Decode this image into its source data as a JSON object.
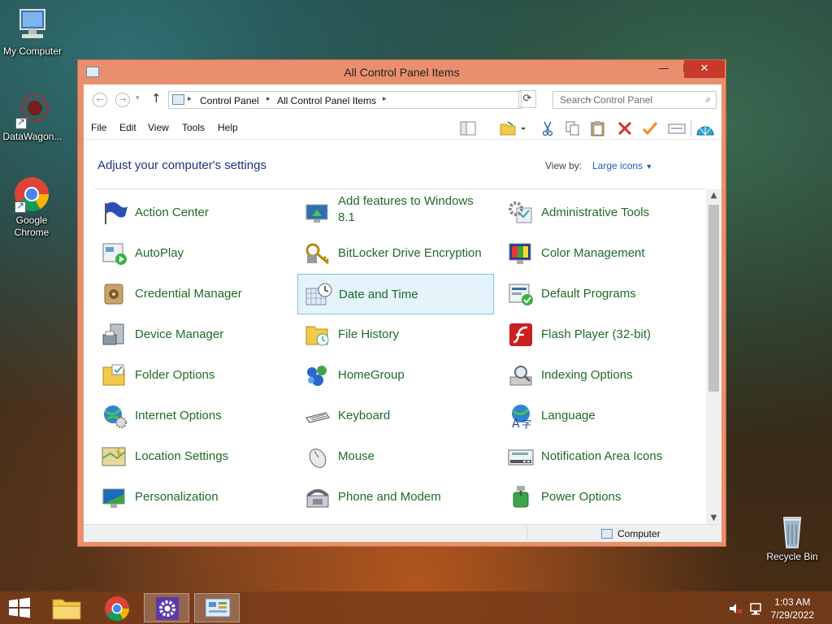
{
  "desktop": {
    "icons": [
      {
        "label": "My Computer"
      },
      {
        "label": "DataWagon..."
      },
      {
        "label": "Google Chrome"
      },
      {
        "label": "Recycle Bin"
      }
    ]
  },
  "window": {
    "title": "All Control Panel Items",
    "buttons": {
      "minimize": "—",
      "maximize": "☐",
      "close": "✕"
    },
    "breadcrumb": [
      "Control Panel",
      "All Control Panel Items"
    ],
    "search_placeholder": "Search Control Panel",
    "menu": [
      "File",
      "Edit",
      "View",
      "Tools",
      "Help"
    ],
    "heading": "Adjust your computer's settings",
    "view_by_label": "View by:",
    "view_by_value": "Large icons",
    "status": "Computer",
    "items": [
      {
        "label": "Action Center",
        "icon": "flag-icon"
      },
      {
        "label": "Add features to Windows 8.1",
        "icon": "monitor-upgrade-icon"
      },
      {
        "label": "Administrative Tools",
        "icon": "gear-tools-icon"
      },
      {
        "label": "AutoPlay",
        "icon": "autoplay-icon"
      },
      {
        "label": "BitLocker Drive Encryption",
        "icon": "key-lock-icon"
      },
      {
        "label": "Color Management",
        "icon": "color-monitor-icon"
      },
      {
        "label": "Credential Manager",
        "icon": "vault-icon"
      },
      {
        "label": "Date and Time",
        "icon": "calendar-clock-icon"
      },
      {
        "label": "Default Programs",
        "icon": "default-check-icon"
      },
      {
        "label": "Device Manager",
        "icon": "printer-device-icon"
      },
      {
        "label": "File History",
        "icon": "file-history-icon"
      },
      {
        "label": "Flash Player (32-bit)",
        "icon": "flash-icon"
      },
      {
        "label": "Folder Options",
        "icon": "folder-options-icon"
      },
      {
        "label": "HomeGroup",
        "icon": "homegroup-icon"
      },
      {
        "label": "Indexing Options",
        "icon": "magnifier-index-icon"
      },
      {
        "label": "Internet Options",
        "icon": "globe-gear-icon"
      },
      {
        "label": "Keyboard",
        "icon": "keyboard-icon"
      },
      {
        "label": "Language",
        "icon": "language-globe-icon"
      },
      {
        "label": "Location Settings",
        "icon": "map-location-icon"
      },
      {
        "label": "Mouse",
        "icon": "mouse-icon"
      },
      {
        "label": "Notification Area Icons",
        "icon": "notification-icon"
      },
      {
        "label": "Personalization",
        "icon": "personalization-icon"
      },
      {
        "label": "Phone and Modem",
        "icon": "phone-icon"
      },
      {
        "label": "Power Options",
        "icon": "power-icon"
      }
    ],
    "selected_item": "Date and Time"
  },
  "taskbar": {
    "time": "1:03 AM",
    "date": "7/29/2022"
  },
  "colors": {
    "window_frame": "#e98f6e",
    "link_green": "#1e6b26",
    "heading_blue": "#1e3287",
    "close_red": "#c7392b",
    "selection": "#e5f3fb"
  }
}
